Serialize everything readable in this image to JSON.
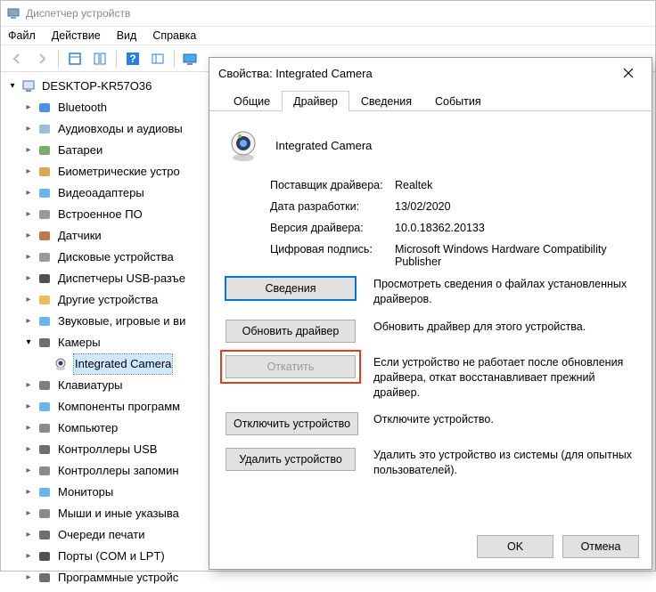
{
  "main_window": {
    "title": "Диспетчер устройств",
    "menu": {
      "file": "Файл",
      "action": "Действие",
      "view": "Вид",
      "help": "Справка"
    },
    "root_node": "DESKTOP-KR57O36",
    "categories": [
      "Bluetooth",
      "Аудиовходы и аудиовы",
      "Батареи",
      "Биометрические устро",
      "Видеоадаптеры",
      "Встроенное ПО",
      "Датчики",
      "Дисковые устройства",
      "Диспетчеры USB-разъе",
      "Другие устройства",
      "Звуковые, игровые и ви",
      "Камеры",
      "Клавиатуры",
      "Компоненты программ",
      "Компьютер",
      "Контроллеры USB",
      "Контроллеры запомин",
      "Мониторы",
      "Мыши и иные указыва",
      "Очереди печати",
      "Порты (COM и LPT)",
      "Программные устройс"
    ],
    "camera_child": "Integrated Camera"
  },
  "dialog": {
    "title": "Свойства: Integrated Camera",
    "tabs": {
      "general": "Общие",
      "driver": "Драйвер",
      "details": "Сведения",
      "events": "События"
    },
    "device_name": "Integrated Camera",
    "fields": {
      "vendor_label": "Поставщик драйвера:",
      "vendor_value": "Realtek",
      "date_label": "Дата разработки:",
      "date_value": "13/02/2020",
      "version_label": "Версия драйвера:",
      "version_value": "10.0.18362.20133",
      "sig_label": "Цифровая подпись:",
      "sig_value": "Microsoft Windows Hardware Compatibility Publisher"
    },
    "buttons": {
      "details": "Сведения",
      "details_desc": "Просмотреть сведения о файлах установленных драйверов.",
      "update": "Обновить драйвер",
      "update_desc": "Обновить драйвер для этого устройства.",
      "rollback": "Откатить",
      "rollback_desc": "Если устройство не работает после обновления драйвера, откат восстанавливает прежний драйвер.",
      "disable": "Отключить устройство",
      "disable_desc": "Отключите устройство.",
      "uninstall": "Удалить устройство",
      "uninstall_desc": "Удалить это устройство из системы (для опытных пользователей).",
      "ok": "OK",
      "cancel": "Отмена"
    }
  }
}
